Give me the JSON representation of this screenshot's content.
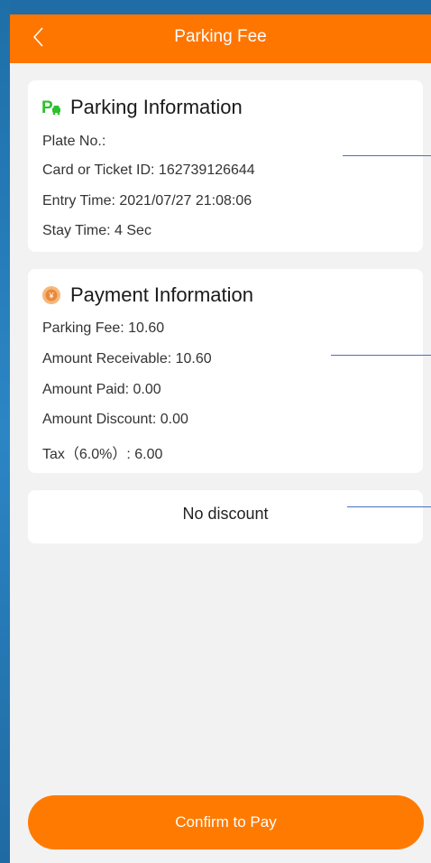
{
  "header": {
    "title": "Parking Fee",
    "back_icon": "chevron-left-icon",
    "background": "#fe7500"
  },
  "parking": {
    "icon": "parking-car-icon",
    "icon_color": "#2cc02c",
    "title": "Parking Information",
    "lines": [
      "Plate No.:",
      "Card or Ticket ID: 162739126644",
      "Entry Time: 2021/07/27 21:08:06",
      "Stay Time: 4 Sec"
    ]
  },
  "payment": {
    "icon": "yen-coin-icon",
    "icon_color": "#f0a050",
    "title": "Payment Information",
    "lines": [
      "Parking Fee: 10.60",
      "Amount Receivable: 10.60",
      "Amount Paid: 0.00",
      "Amount Discount: 0.00",
      "Tax（6.0%）: 6.00"
    ]
  },
  "discount": {
    "label": "No discount"
  },
  "footer": {
    "pay_label": "Confirm to Pay",
    "button_color": "#ff7a00"
  }
}
